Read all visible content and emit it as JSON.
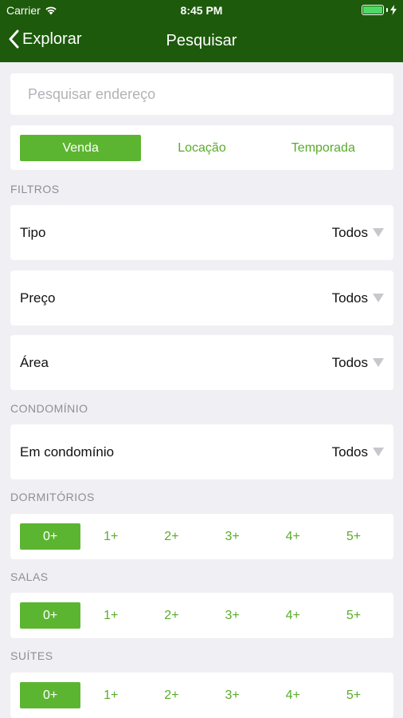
{
  "status_bar": {
    "carrier": "Carrier",
    "time": "8:45 PM"
  },
  "nav": {
    "back_label": "Explorar",
    "title": "Pesquisar"
  },
  "search": {
    "placeholder": "Pesquisar endereço",
    "value": ""
  },
  "segments": {
    "items": [
      "Venda",
      "Locação",
      "Temporada"
    ],
    "selected": "Venda"
  },
  "filtros": {
    "header": "FILTROS",
    "rows": [
      {
        "label": "Tipo",
        "value": "Todos"
      },
      {
        "label": "Preço",
        "value": "Todos"
      },
      {
        "label": "Área",
        "value": "Todos"
      }
    ]
  },
  "condominio": {
    "header": "CONDOMÍNIO",
    "row": {
      "label": "Em condomínio",
      "value": "Todos"
    }
  },
  "dormitorios": {
    "header": "DORMITÓRIOS",
    "options": [
      "0+",
      "1+",
      "2+",
      "3+",
      "4+",
      "5+"
    ],
    "selected": "0+"
  },
  "salas": {
    "header": "SALAS",
    "options": [
      "0+",
      "1+",
      "2+",
      "3+",
      "4+",
      "5+"
    ],
    "selected": "0+"
  },
  "suites": {
    "header": "SUÍTES",
    "options": [
      "0+",
      "1+",
      "2+",
      "3+",
      "4+",
      "5+"
    ],
    "selected": "0+"
  },
  "colors": {
    "nav_bg": "#1d5a0c",
    "accent": "#5cb531",
    "accent_text": "#5aab2b",
    "background": "#efeff4"
  }
}
